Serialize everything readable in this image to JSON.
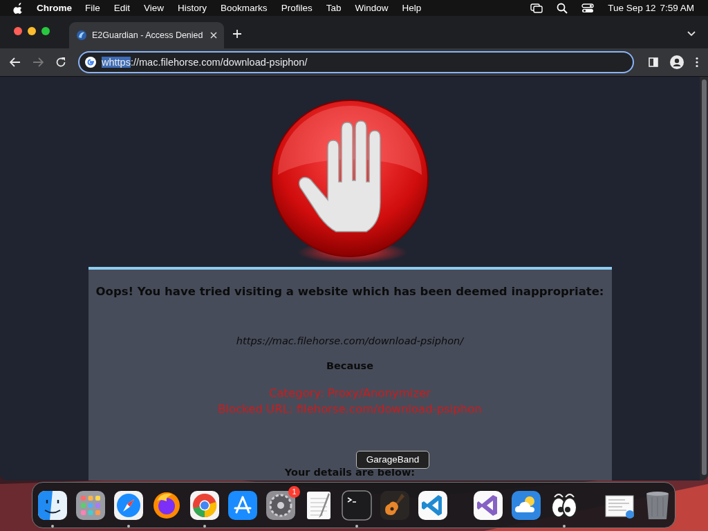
{
  "menu_bar": {
    "app": "Chrome",
    "menus": [
      "File",
      "Edit",
      "View",
      "History",
      "Bookmarks",
      "Profiles",
      "Tab",
      "Window",
      "Help"
    ],
    "date": "Tue Sep 12",
    "time": "7:59 AM"
  },
  "tabs": [
    {
      "title": "E2Guardian - Access Denied",
      "selected": true
    }
  ],
  "address_bar": {
    "selected_text": "whttps",
    "text": "://mac.filehorse.com/download-psiphon/"
  },
  "page": {
    "heading": "Oops! You have tried visiting a website which has been deemed inappropriate:",
    "url": "https://mac.filehorse.com/download-psiphon/",
    "because": "Because",
    "reasons": [
      "Category: Proxy/Anonymizer",
      "Blocked URL: filehorse.com/download-psiphon"
    ],
    "details": "Your details are below:"
  },
  "dock": {
    "tooltip": "GarageBand",
    "groups": [
      [
        {
          "kind": "finder",
          "running": true
        },
        {
          "kind": "launchpad",
          "running": false
        },
        {
          "kind": "safari",
          "running": true
        },
        {
          "kind": "firefox",
          "running": false
        },
        {
          "kind": "chrome",
          "running": true
        },
        {
          "kind": "appstore",
          "running": false
        },
        {
          "kind": "settings",
          "running": false,
          "badge": "1"
        },
        {
          "kind": "textedit",
          "running": false
        },
        {
          "kind": "terminal",
          "running": true
        },
        {
          "kind": "garageband",
          "running": false,
          "hovered": true
        },
        {
          "kind": "vscode",
          "running": false
        }
      ],
      [
        {
          "kind": "visualstudio",
          "running": false
        },
        {
          "kind": "weather",
          "running": false
        },
        {
          "kind": "eyes",
          "running": true
        }
      ],
      [
        {
          "kind": "document",
          "running": false
        },
        {
          "kind": "trash",
          "running": false
        }
      ]
    ]
  }
}
